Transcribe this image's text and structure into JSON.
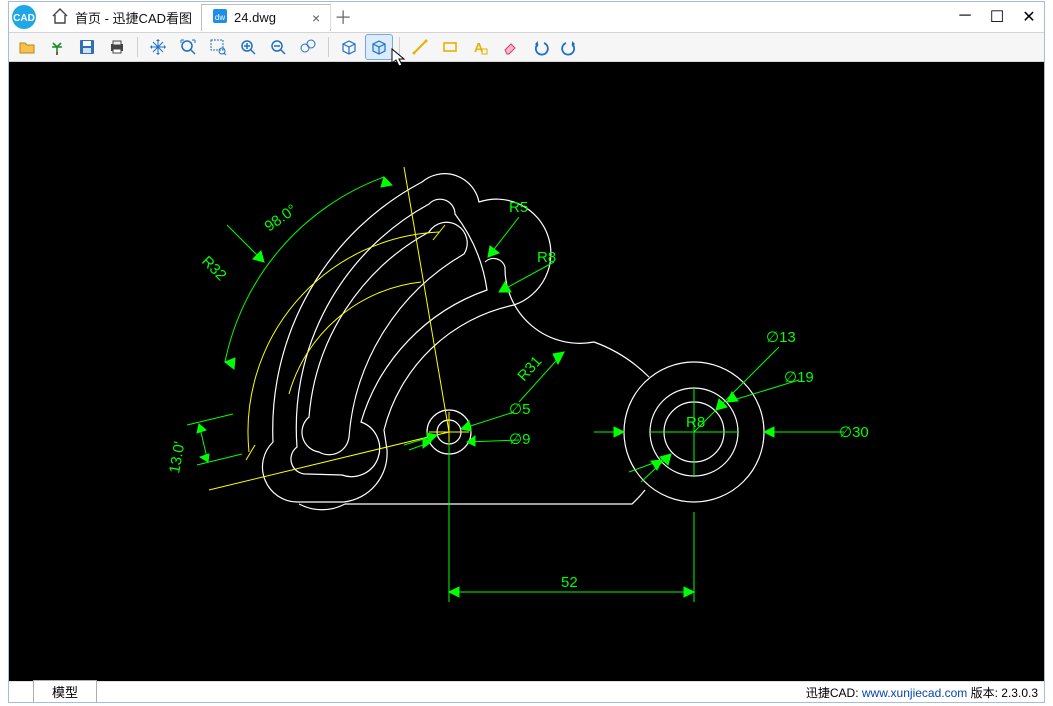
{
  "app": {
    "name": "迅捷CAD",
    "website": "www.xunjiecad.com",
    "version_label": "版本",
    "version": "2.3.0.3"
  },
  "tabs": {
    "home_label": "首页 - 迅捷CAD看图",
    "file_label": "24.dwg"
  },
  "bottom": {
    "model_tab": "模型"
  },
  "drawing": {
    "angle_label": "98.0°",
    "R32": "R32",
    "R5": "R5",
    "R8_top": "R8",
    "R31": "R31",
    "len13": "13.0'",
    "d5": "∅5",
    "d9": "∅9",
    "R8_right": "R8",
    "d13": "∅13",
    "d19": "∅19",
    "d30": "∅30",
    "dist52": "52"
  }
}
